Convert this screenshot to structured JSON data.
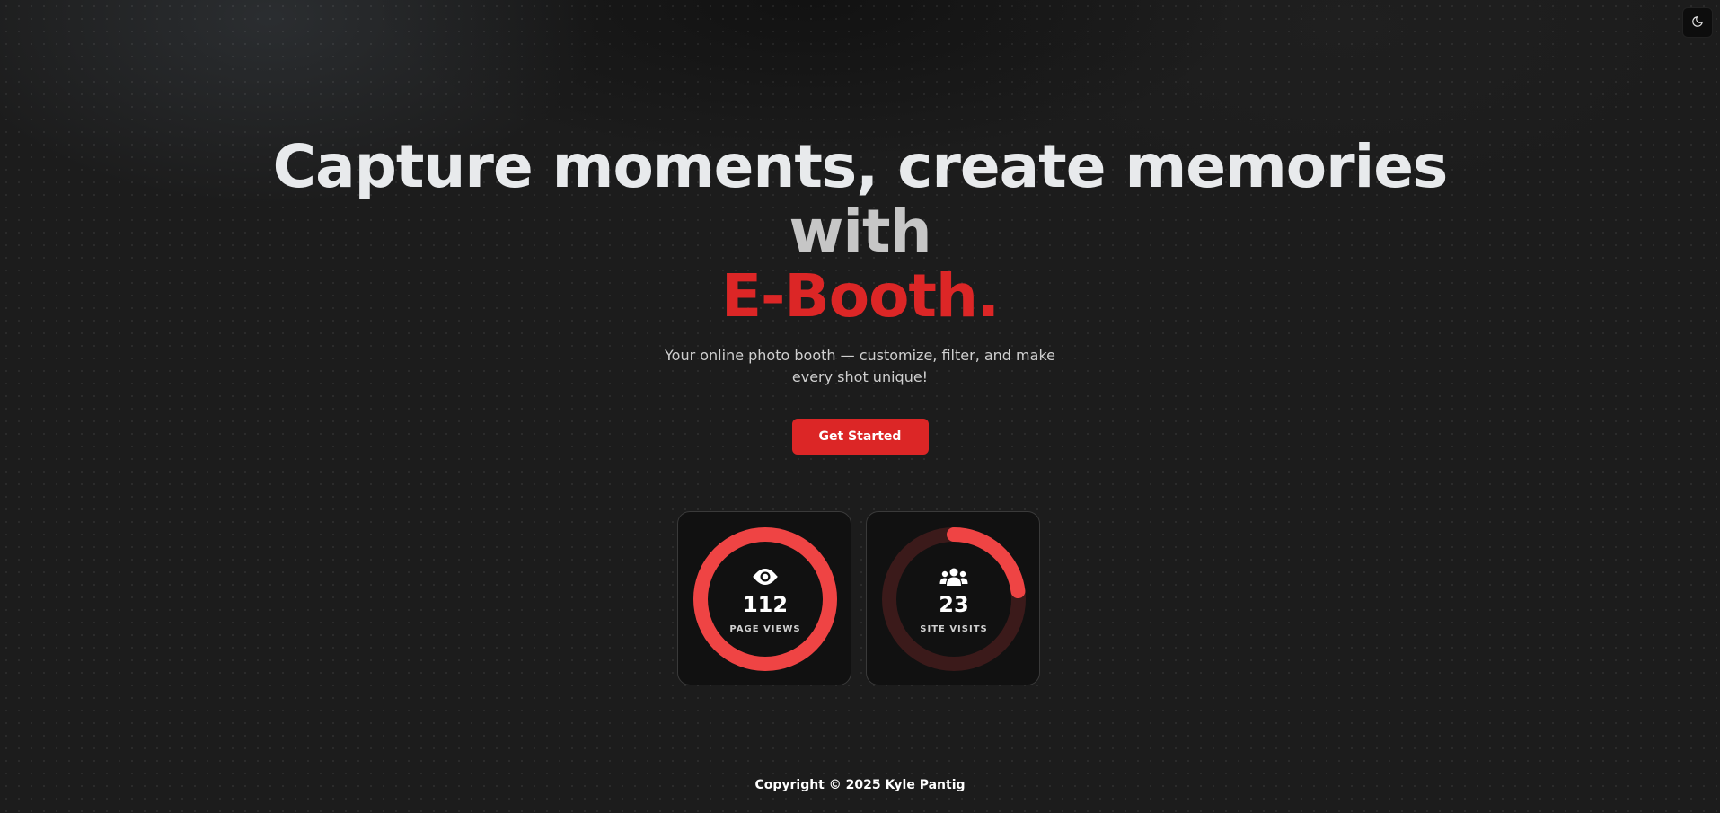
{
  "theme_toggle": {
    "icon": "moon-icon"
  },
  "hero": {
    "line1": "Capture moments, create memories",
    "line2": "with",
    "brand": "E-Booth.",
    "subtitle": "Your online photo booth — customize, filter, and make every shot unique!",
    "cta_label": "Get Started"
  },
  "stats": {
    "page_views": {
      "value": "112",
      "label": "PAGE VIEWS",
      "icon": "eye-icon",
      "progress": 1.0
    },
    "site_visits": {
      "value": "23",
      "label": "SITE VISITS",
      "icon": "users-icon",
      "progress": 0.23
    }
  },
  "colors": {
    "accent": "#dc2626",
    "ring_fg": "#ef4444",
    "ring_bg": "#3b1a1a"
  },
  "footer": {
    "copyright": "Copyright © 2025 Kyle Pantig"
  }
}
